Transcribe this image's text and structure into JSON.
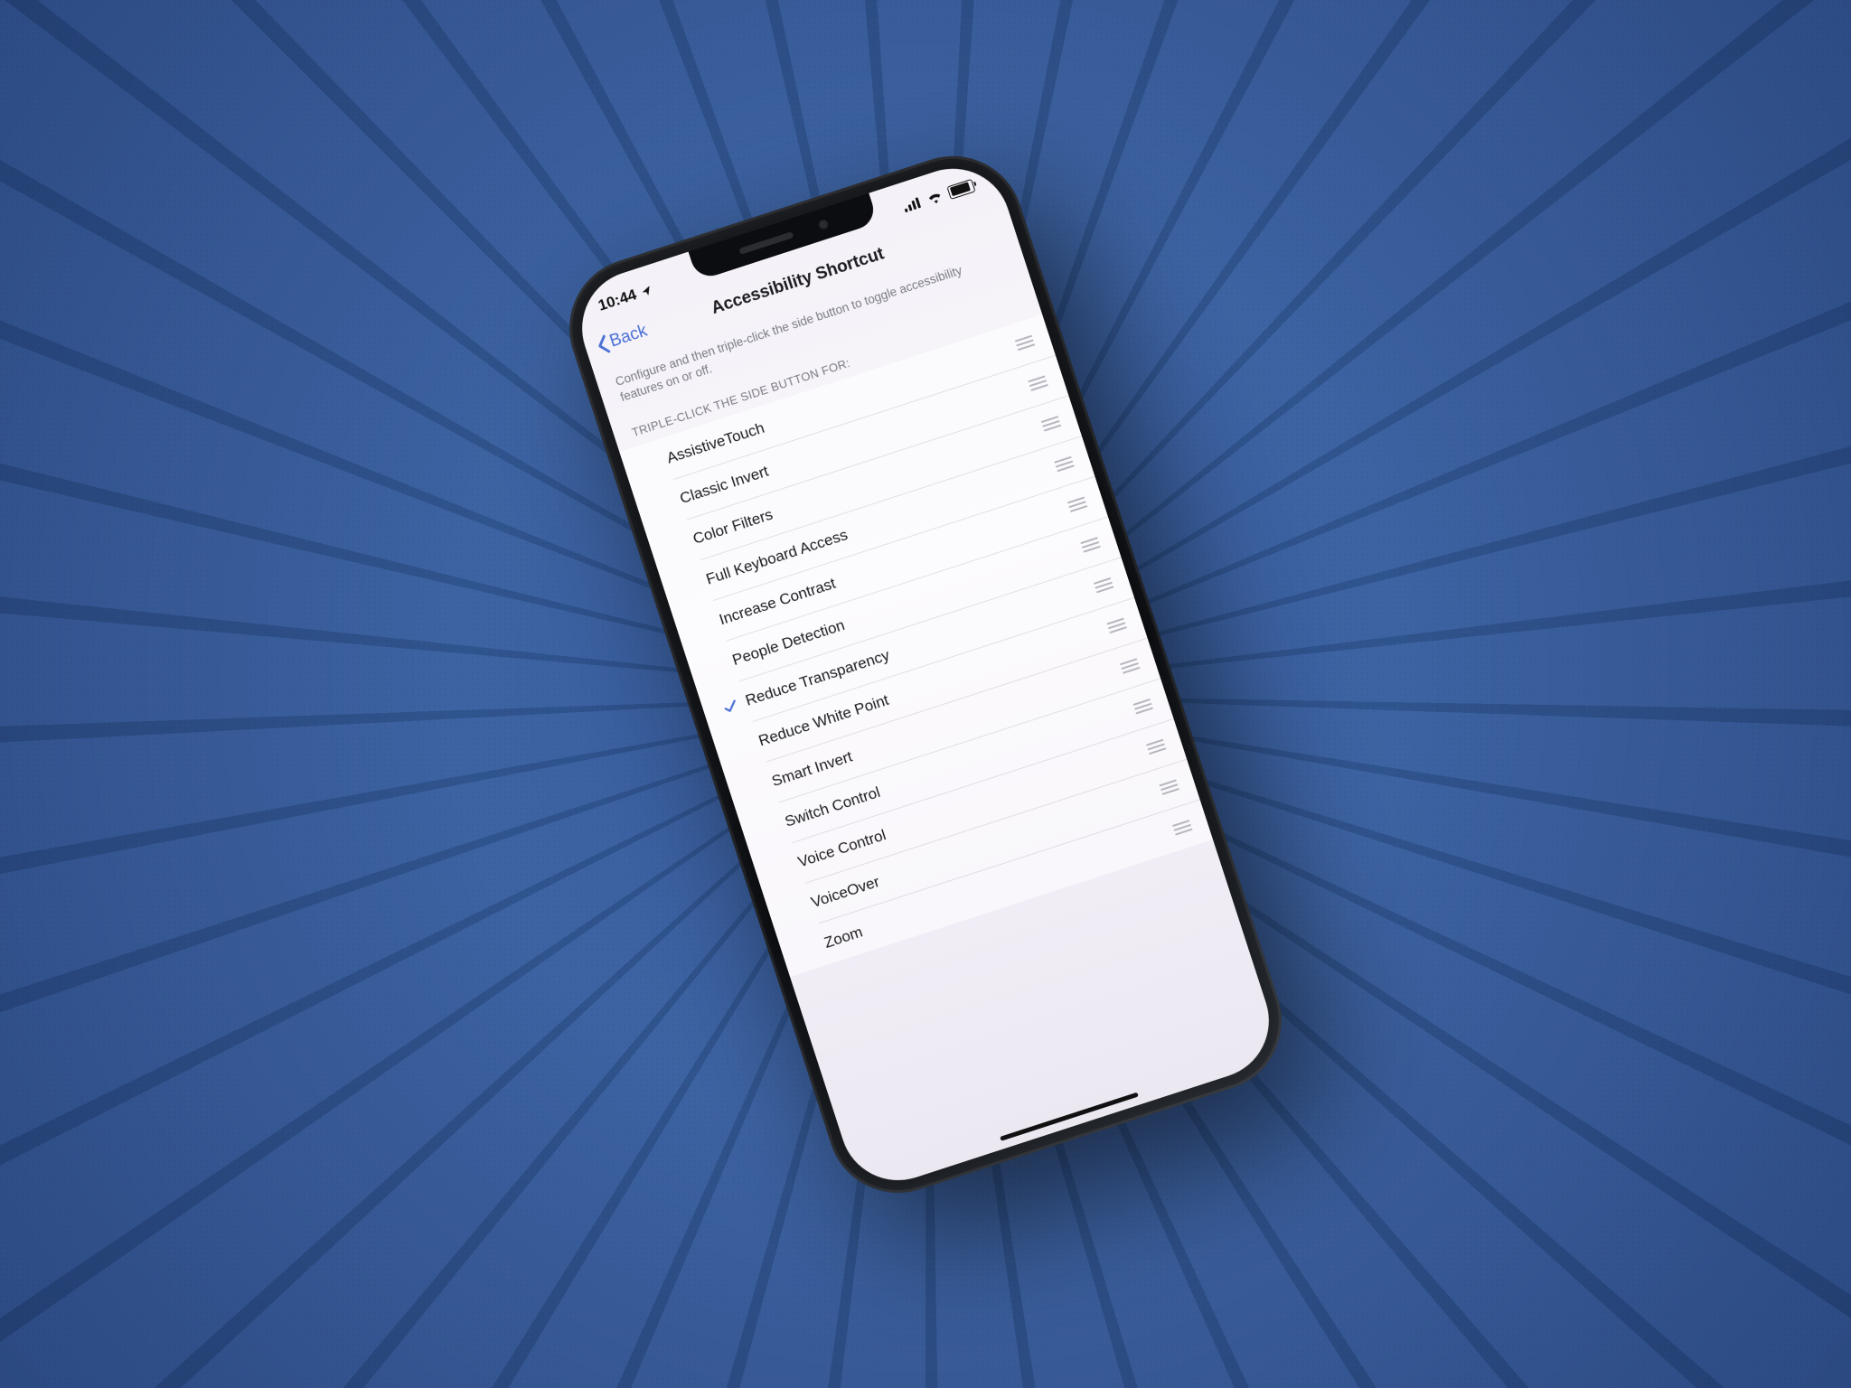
{
  "status": {
    "time": "10:44"
  },
  "nav": {
    "back": "Back",
    "title": "Accessibility Shortcut"
  },
  "description": "Configure and then triple-click the side button to toggle accessibility features on or off.",
  "section_header": "TRIPLE-CLICK THE SIDE BUTTON FOR:",
  "items": [
    {
      "label": "AssistiveTouch",
      "checked": false
    },
    {
      "label": "Classic Invert",
      "checked": false
    },
    {
      "label": "Color Filters",
      "checked": false
    },
    {
      "label": "Full Keyboard Access",
      "checked": false
    },
    {
      "label": "Increase Contrast",
      "checked": false
    },
    {
      "label": "People Detection",
      "checked": false
    },
    {
      "label": "Reduce Transparency",
      "checked": true
    },
    {
      "label": "Reduce White Point",
      "checked": false
    },
    {
      "label": "Smart Invert",
      "checked": false
    },
    {
      "label": "Switch Control",
      "checked": false
    },
    {
      "label": "Voice Control",
      "checked": false
    },
    {
      "label": "VoiceOver",
      "checked": false
    },
    {
      "label": "Zoom",
      "checked": false
    }
  ]
}
